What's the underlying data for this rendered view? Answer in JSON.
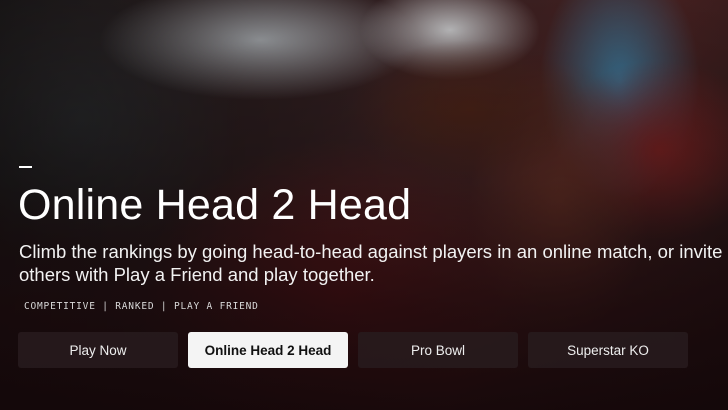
{
  "hero": {
    "title": "Online Head 2 Head",
    "description": "Climb the rankings by going head-to-head against players in an online match, or invite others with Play a Friend and play together.",
    "tags": "COMPETITIVE | RANKED | PLAY A FRIEND"
  },
  "modes": [
    {
      "label": "Play Now",
      "selected": false
    },
    {
      "label": "Online Head 2 Head",
      "selected": true
    },
    {
      "label": "Pro Bowl",
      "selected": false
    },
    {
      "label": "Superstar KO",
      "selected": false
    }
  ],
  "colors": {
    "selected_bg": "#f4f4f4",
    "unselected_bg": "#281c1e"
  }
}
